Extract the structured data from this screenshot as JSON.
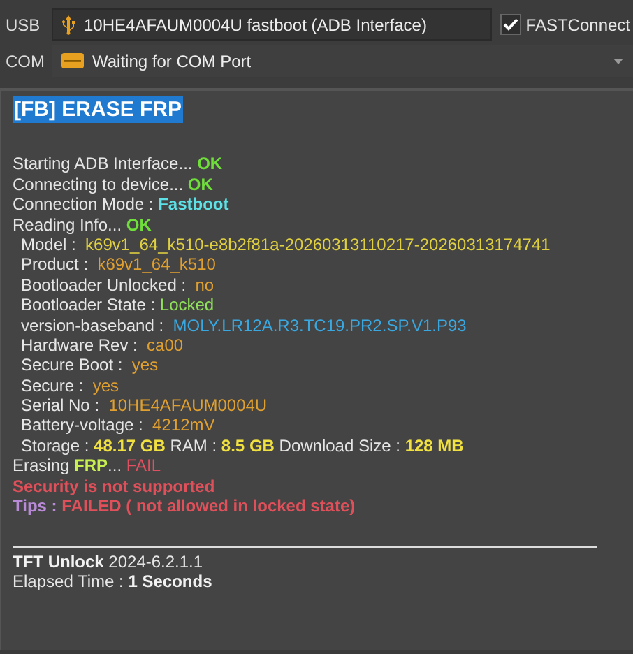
{
  "usb": {
    "label": "USB",
    "device": "10HE4AFAUM0004U  fastboot (ADB Interface)",
    "fastconnect": {
      "label": "FASTConnect",
      "checked": true
    }
  },
  "com": {
    "label": "COM",
    "value": "Waiting for COM Port"
  },
  "log": {
    "title": "[FB] ERASE FRP",
    "lines": [
      {
        "kind": "blank"
      },
      {
        "kind": "plain",
        "segments": [
          {
            "text": "Starting ADB Interface... ",
            "color": "#e6e6e6",
            "bold": false
          },
          {
            "text": "OK",
            "color": "#6fe03a",
            "bold": true
          }
        ]
      },
      {
        "kind": "plain",
        "segments": [
          {
            "text": "Connecting to device... ",
            "color": "#e6e6e6",
            "bold": false
          },
          {
            "text": "OK",
            "color": "#6fe03a",
            "bold": true
          }
        ]
      },
      {
        "kind": "plain",
        "segments": [
          {
            "text": "Connection Mode : ",
            "color": "#e6e6e6",
            "bold": false
          },
          {
            "text": "Fastboot",
            "color": "#5ce1e6",
            "bold": true
          }
        ]
      },
      {
        "kind": "plain",
        "segments": [
          {
            "text": "Reading Info... ",
            "color": "#e6e6e6",
            "bold": false
          },
          {
            "text": "OK",
            "color": "#6fe03a",
            "bold": true
          }
        ]
      },
      {
        "kind": "detail",
        "segments": [
          {
            "text": "Model :  ",
            "color": "#e6e6e6",
            "bold": false
          },
          {
            "text": "k69v1_64_k510-e8b2f81a-20260313110217-20260313174741",
            "color": "#e0d040",
            "bold": false
          }
        ]
      },
      {
        "kind": "detail",
        "segments": [
          {
            "text": "Product :  ",
            "color": "#e6e6e6",
            "bold": false
          },
          {
            "text": "k69v1_64_k510",
            "color": "#e0a030",
            "bold": false
          }
        ]
      },
      {
        "kind": "detail",
        "segments": [
          {
            "text": "Bootloader Unlocked :  ",
            "color": "#e6e6e6",
            "bold": false
          },
          {
            "text": "no",
            "color": "#e0a030",
            "bold": false
          }
        ]
      },
      {
        "kind": "detail",
        "segments": [
          {
            "text": "Bootloader State : ",
            "color": "#e6e6e6",
            "bold": false
          },
          {
            "text": "Locked",
            "color": "#8fe05a",
            "bold": false
          }
        ]
      },
      {
        "kind": "detail",
        "segments": [
          {
            "text": "version-baseband :  ",
            "color": "#e6e6e6",
            "bold": false
          },
          {
            "text": "MOLY.LR12A.R3.TC19.PR2.SP.V1.P93",
            "color": "#3aa8e0",
            "bold": false
          }
        ]
      },
      {
        "kind": "detail",
        "segments": [
          {
            "text": "Hardware Rev :  ",
            "color": "#e6e6e6",
            "bold": false
          },
          {
            "text": "ca00",
            "color": "#e0a030",
            "bold": false
          }
        ]
      },
      {
        "kind": "detail",
        "segments": [
          {
            "text": "Secure Boot :  ",
            "color": "#e6e6e6",
            "bold": false
          },
          {
            "text": "yes",
            "color": "#e0a030",
            "bold": false
          }
        ]
      },
      {
        "kind": "detail",
        "segments": [
          {
            "text": "Secure :  ",
            "color": "#e6e6e6",
            "bold": false
          },
          {
            "text": "yes",
            "color": "#e0a030",
            "bold": false
          }
        ]
      },
      {
        "kind": "detail",
        "segments": [
          {
            "text": "Serial No :  ",
            "color": "#e6e6e6",
            "bold": false
          },
          {
            "text": "10HE4AFAUM0004U",
            "color": "#e0a030",
            "bold": false
          }
        ]
      },
      {
        "kind": "detail",
        "segments": [
          {
            "text": "Battery-voltage :  ",
            "color": "#e6e6e6",
            "bold": false
          },
          {
            "text": "4212mV",
            "color": "#e0a030",
            "bold": false
          }
        ]
      },
      {
        "kind": "detail",
        "segments": [
          {
            "text": "Storage : ",
            "color": "#e6e6e6",
            "bold": false
          },
          {
            "text": "48.17 GB",
            "color": "#f0e040",
            "bold": true
          },
          {
            "text": " RAM : ",
            "color": "#e6e6e6",
            "bold": false
          },
          {
            "text": "8.5 GB",
            "color": "#f0e040",
            "bold": true
          },
          {
            "text": " Download Size : ",
            "color": "#e6e6e6",
            "bold": false
          },
          {
            "text": "128 MB",
            "color": "#f0e040",
            "bold": true
          }
        ]
      },
      {
        "kind": "plain",
        "segments": [
          {
            "text": "Erasing ",
            "color": "#e6e6e6",
            "bold": false
          },
          {
            "text": "FRP",
            "color": "#c8f050",
            "bold": true
          },
          {
            "text": "... ",
            "color": "#e6e6e6",
            "bold": false
          },
          {
            "text": "FAIL",
            "color": "#e05060",
            "bold": false
          }
        ]
      },
      {
        "kind": "plain",
        "segments": [
          {
            "text": "Security is not supported",
            "color": "#e0505a",
            "bold": true
          }
        ]
      },
      {
        "kind": "plain",
        "segments": [
          {
            "text": "Tips : ",
            "color": "#b88ad8",
            "bold": true
          },
          {
            "text": "FAILED ( not allowed in locked state)",
            "color": "#e0505a",
            "bold": true
          }
        ]
      },
      {
        "kind": "blank"
      },
      {
        "kind": "rule"
      },
      {
        "kind": "plain",
        "segments": [
          {
            "text": "TFT Unlock",
            "color": "#f2f2f2",
            "bold": true
          },
          {
            "text": " 2024-6.2.1.1",
            "color": "#e6e6e6",
            "bold": false
          }
        ]
      },
      {
        "kind": "plain",
        "segments": [
          {
            "text": "Elapsed Time : ",
            "color": "#e6e6e6",
            "bold": false
          },
          {
            "text": "1 Seconds",
            "color": "#f2f2f2",
            "bold": true
          }
        ]
      }
    ]
  }
}
